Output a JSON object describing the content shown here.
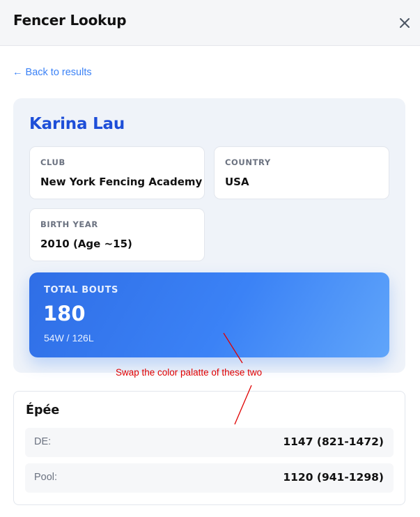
{
  "header": {
    "title": "Fencer Lookup",
    "close_icon": "close-icon"
  },
  "nav": {
    "back_label": "← Back to results"
  },
  "fencer": {
    "name": "Karina Lau",
    "club_label": "CLUB",
    "club": "New York Fencing Academy",
    "country_label": "COUNTRY",
    "country": "USA",
    "birth_year_label": "BIRTH YEAR",
    "birth_year": "2010 (Age ~15)"
  },
  "bouts": {
    "label": "TOTAL BOUTS",
    "total": "180",
    "record": "54W / 126L"
  },
  "annotation": {
    "text": "Swap the color palatte of these two",
    "color": "#e00000"
  },
  "weapon": {
    "name": "Épée",
    "rows": [
      {
        "label": "DE:",
        "value": "1147 (821-1472)"
      },
      {
        "label": "Pool:",
        "value": "1120 (941-1298)"
      }
    ]
  },
  "colors": {
    "accent": "#3b82f6",
    "name_color": "#1d4ed8",
    "card_bg": "#eff3f9",
    "header_bg": "#f5f6f8"
  }
}
